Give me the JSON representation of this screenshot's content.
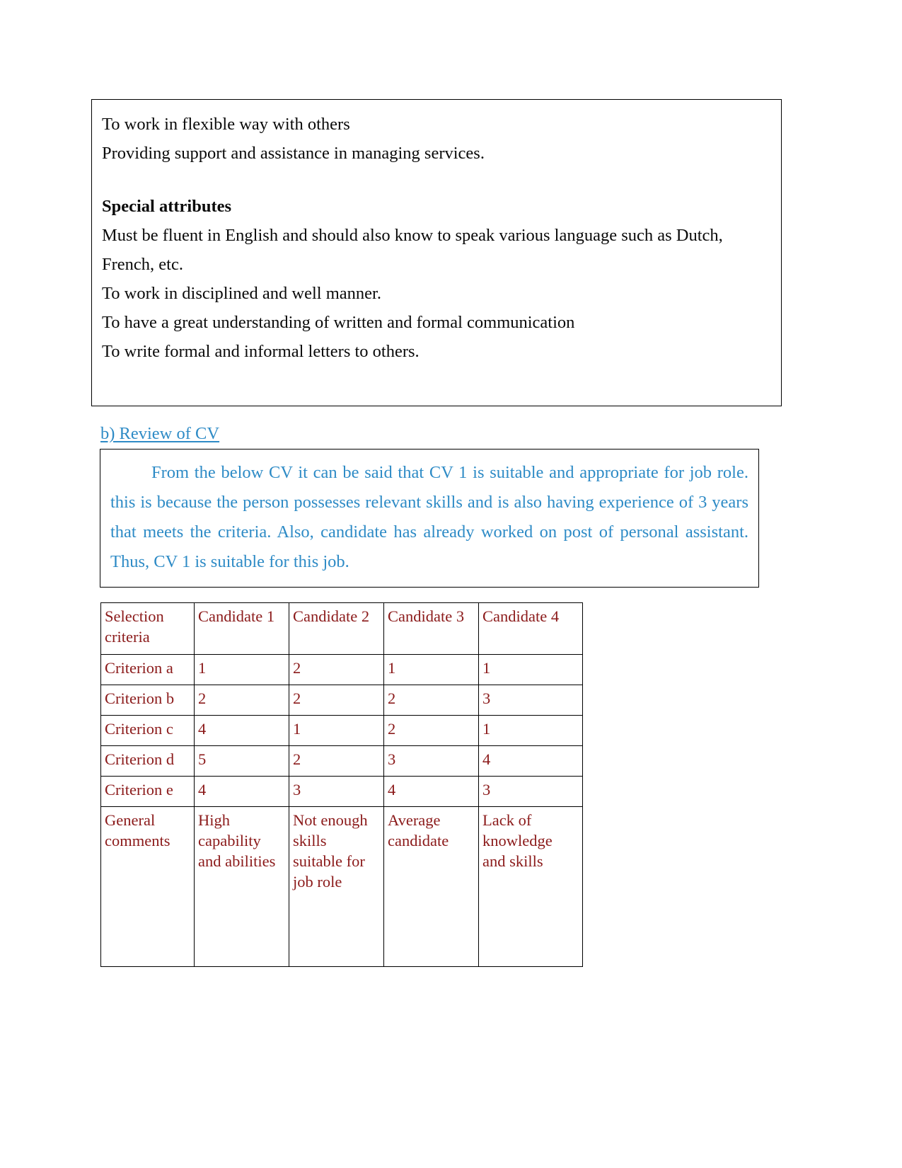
{
  "colors": {
    "body_text": "#0a0a0a",
    "blue_text": "#2E8BC6",
    "table_text": "#8B1A1A",
    "border": "#000000"
  },
  "job_description_box": {
    "lines": [
      "To work in flexible way with others",
      "Providing support and assistance in managing services."
    ],
    "special_attributes_heading": "Special attributes",
    "special_attributes_lines": [
      "Must be fluent in English and should also know to speak various language such as Dutch, French, etc.",
      "To work in disciplined and well manner.",
      "To have a great understanding of written and formal communication",
      "To write formal and informal letters to others."
    ]
  },
  "review_section": {
    "heading": "b) Review of CV",
    "paragraph": "From the below CV it can be said that CV 1 is suitable and appropriate for job role. this is because the person possesses relevant skills and is also having experience of 3 years that meets the criteria. Also, candidate has already worked on post of personal assistant. Thus, CV 1 is suitable for this job."
  },
  "selection_table": {
    "headers": [
      "Selection criteria",
      "Candidate 1",
      "Candidate 2",
      "Candidate 3",
      "Candidate 4"
    ],
    "rows": [
      {
        "criterion": "Criterion a",
        "c1": "1",
        "c2": "2",
        "c3": "1",
        "c4": "1"
      },
      {
        "criterion": "Criterion b",
        "c1": "2",
        "c2": "2",
        "c3": "2",
        "c4": "3"
      },
      {
        "criterion": "Criterion c",
        "c1": "4",
        "c2": "1",
        "c3": "2",
        "c4": "1"
      },
      {
        "criterion": "Criterion d",
        "c1": "5",
        "c2": "2",
        "c3": "3",
        "c4": "4"
      },
      {
        "criterion": "Criterion e",
        "c1": "4",
        "c2": "3",
        "c3": "4",
        "c4": "3"
      }
    ],
    "comments_row": {
      "label": "General comments",
      "c1": "High capability and abilities",
      "c2": "Not enough skills suitable for job role",
      "c3": "Average candidate",
      "c4": "Lack of knowledge and skills"
    }
  }
}
